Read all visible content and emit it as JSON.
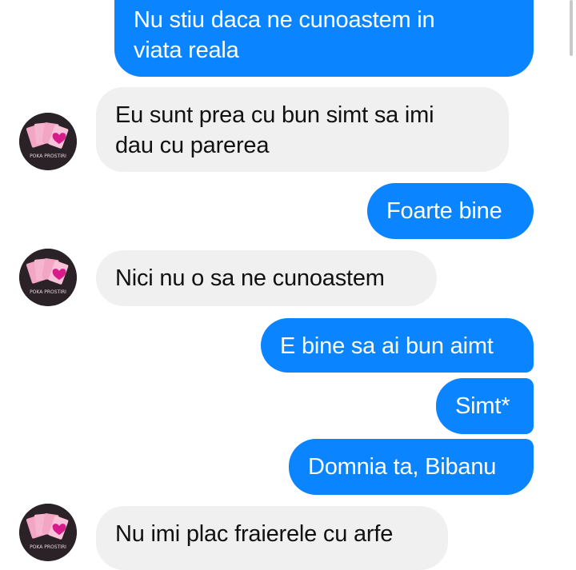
{
  "conversation": {
    "contact_avatar_icon": "playing-cards-heart-icon",
    "contact_avatar_caption": "POKA PROSTIRI",
    "colors": {
      "sent_bubble": "#0a84ff",
      "received_bubble": "#f0f0f0",
      "sent_text": "#ffffff",
      "received_text": "#111111"
    },
    "messages": [
      {
        "direction": "sent",
        "text": "Nu stiu daca ne cunoastem in\nviata reala"
      },
      {
        "direction": "received",
        "text": "Eu sunt prea cu bun simt sa imi\ndau cu parerea"
      },
      {
        "direction": "sent",
        "text": "Foarte bine"
      },
      {
        "direction": "received",
        "text": "Nici nu o sa ne cunoastem"
      },
      {
        "direction": "sent",
        "text": "E bine sa ai bun aimt"
      },
      {
        "direction": "sent",
        "text": "Simt*"
      },
      {
        "direction": "sent",
        "text": "Domnia ta, Bibanu"
      },
      {
        "direction": "received",
        "text": "Nu imi plac fraierele cu arfe"
      }
    ]
  }
}
